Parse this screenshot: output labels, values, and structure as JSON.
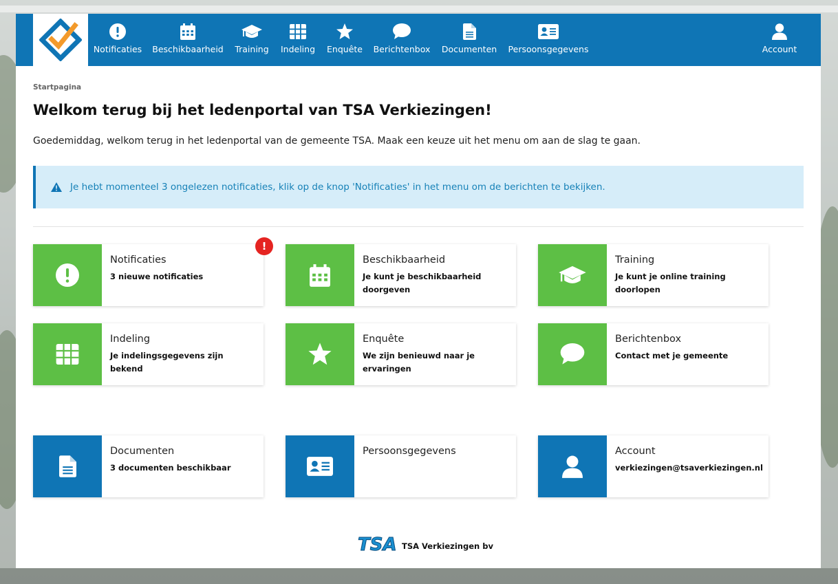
{
  "nav": {
    "items": [
      {
        "label": "Notificaties",
        "icon": "exclamation-circle-icon"
      },
      {
        "label": "Beschikbaarheid",
        "icon": "calendar-icon"
      },
      {
        "label": "Training",
        "icon": "graduation-cap-icon"
      },
      {
        "label": "Indeling",
        "icon": "grid-icon"
      },
      {
        "label": "Enquête",
        "icon": "star-icon"
      },
      {
        "label": "Berichtenbox",
        "icon": "chat-bubble-icon"
      },
      {
        "label": "Documenten",
        "icon": "document-icon"
      },
      {
        "label": "Persoonsgegevens",
        "icon": "id-card-icon"
      }
    ],
    "account_label": "Account"
  },
  "page": {
    "breadcrumb": "Startpagina",
    "title": "Welkom terug bij het ledenportal van TSA Verkiezingen!",
    "intro": "Goedemiddag, welkom terug in het ledenportal van de gemeente TSA. Maak een keuze uit het menu om aan de slag te gaan."
  },
  "alert": {
    "text": "Je hebt momenteel 3 ongelezen notificaties, klik op de knop 'Notificaties' in het menu om de berichten te bekijken."
  },
  "tiles": [
    {
      "title": "Notificaties",
      "subtitle": "3 nieuwe notificaties",
      "color": "green"
    },
    {
      "title": "Beschikbaarheid",
      "subtitle": "Je kunt je beschikbaarheid doorgeven",
      "color": "green"
    },
    {
      "title": "Training",
      "subtitle": "Je kunt je online training doorlopen",
      "color": "green"
    },
    {
      "title": "Indeling",
      "subtitle": "Je indelingsgegevens zijn bekend",
      "color": "green"
    },
    {
      "title": "Enquête",
      "subtitle": "We zijn benieuwd naar je ervaringen",
      "color": "green"
    },
    {
      "title": "Berichtenbox",
      "subtitle": "Contact met je gemeente",
      "color": "green"
    },
    {
      "title": "Documenten",
      "subtitle": "3 documenten beschikbaar",
      "color": "blue"
    },
    {
      "title": "Persoonsgegevens",
      "subtitle": "",
      "color": "blue"
    },
    {
      "title": "Account",
      "subtitle": "verkiezingen@tsaverkiezingen.nl",
      "color": "blue"
    }
  ],
  "badge": {
    "symbol": "!"
  },
  "footer": {
    "logo_letters": "TSA",
    "company": "TSA Verkiezingen bv"
  },
  "colors": {
    "primary": "#0f75b5",
    "green": "#5dbf45",
    "alert_bg": "#d6edf9",
    "badge": "#e52421"
  }
}
